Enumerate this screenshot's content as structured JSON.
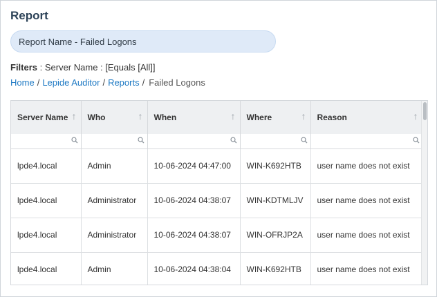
{
  "page": {
    "title": "Report"
  },
  "report_name": "Report Name - Failed Logons",
  "filters": {
    "label": "Filters",
    "text": " : Server Name : [Equals [All]]"
  },
  "breadcrumb": {
    "items": [
      "Home",
      "Lepide Auditor",
      "Reports"
    ],
    "separator": "/",
    "current": "Failed Logons"
  },
  "table": {
    "columns": [
      "Server Name",
      "Who",
      "When",
      "Where",
      "Reason"
    ],
    "sort_icon": "↑",
    "rows": [
      [
        "lpde4.local",
        "Admin",
        "10-06-2024 04:47:00",
        "WIN-K692HTB",
        "user name does not exist"
      ],
      [
        "lpde4.local",
        "Administrator",
        "10-06-2024 04:38:07",
        "WIN-KDTMLJV",
        "user name does not exist"
      ],
      [
        "lpde4.local",
        "Administrator",
        "10-06-2024 04:38:07",
        "WIN-OFRJP2A",
        "user name does not exist"
      ],
      [
        "lpde4.local",
        "Admin",
        "10-06-2024 04:38:04",
        "WIN-K692HTB",
        "user name does not exist"
      ]
    ]
  },
  "colors": {
    "link": "#1f7ac4",
    "title": "#2d4358",
    "pill_bg": "#dfeaf8",
    "header_bg": "#eef0f2"
  }
}
